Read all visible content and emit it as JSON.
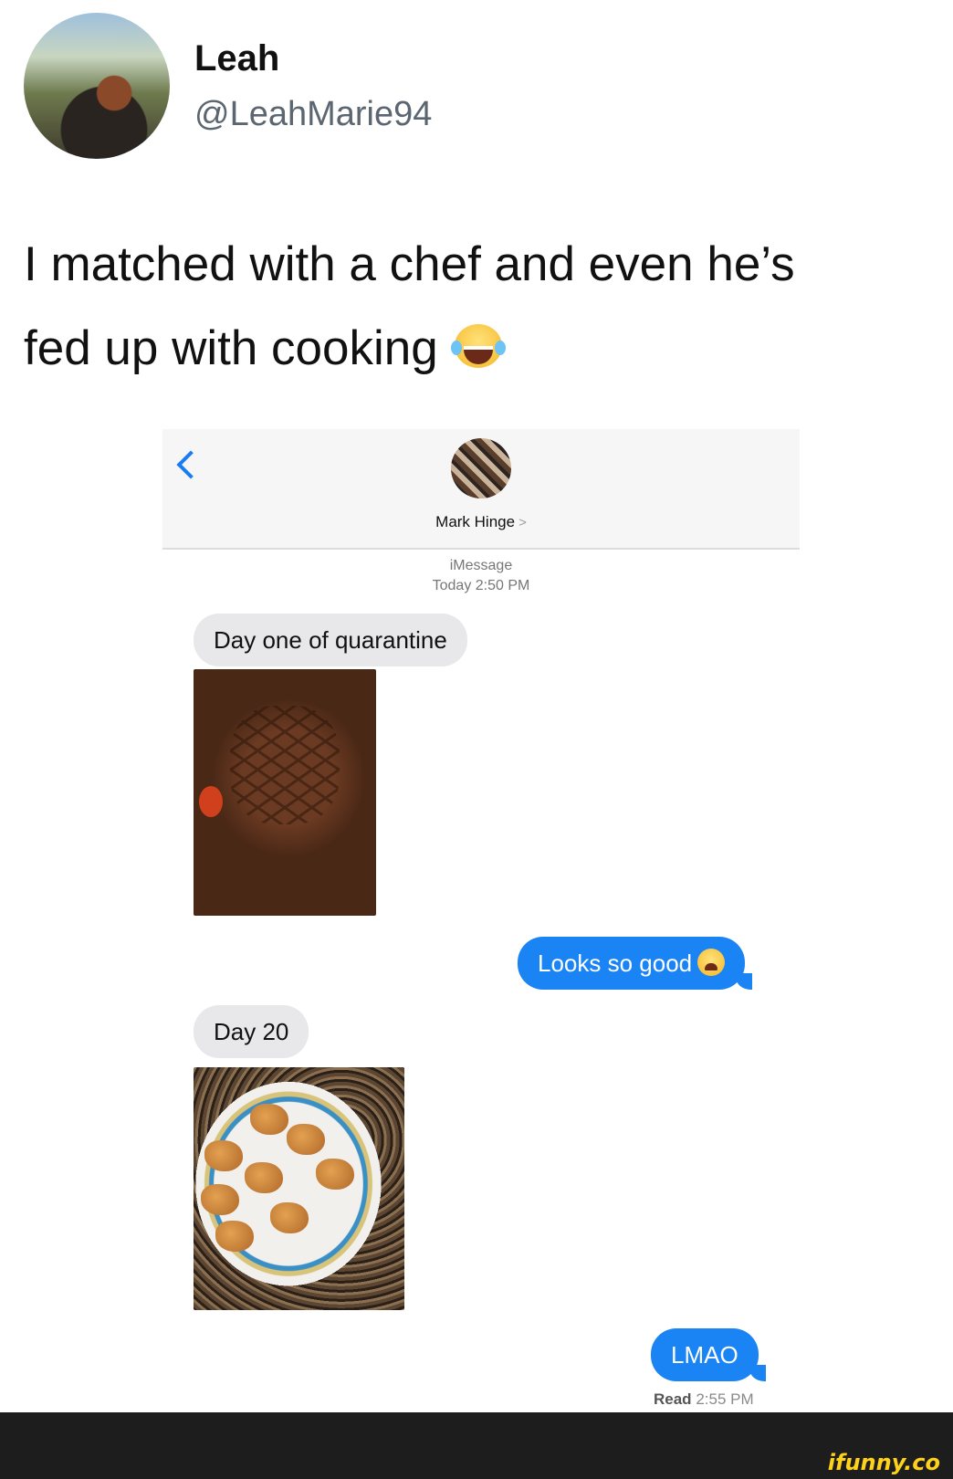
{
  "tweet": {
    "display_name": "Leah",
    "handle": "@LeahMarie94",
    "text_line1": "I matched with a chef and even he’s",
    "text_line2": "fed up with cooking",
    "emoji": "face-with-tears-of-joy"
  },
  "conversation": {
    "contact_name": "Mark Hinge",
    "contact_chevron": ">",
    "service": "iMessage",
    "timestamp": "Today 2:50 PM",
    "messages": [
      {
        "direction": "incoming",
        "text": "Day one of quarantine"
      },
      {
        "direction": "incoming",
        "image": "steak-photo"
      },
      {
        "direction": "outgoing",
        "text": "Looks so good",
        "emoji": "weary-face"
      },
      {
        "direction": "incoming",
        "text": "Day 20"
      },
      {
        "direction": "incoming",
        "image": "chicken-nuggets-photo"
      },
      {
        "direction": "outgoing",
        "text": "LMAO"
      }
    ],
    "read_label": "Read",
    "read_time": "2:55 PM"
  },
  "watermark": "ifunny.co",
  "colors": {
    "outgoing_bubble": "#1a84f5",
    "incoming_bubble": "#e8e8ea",
    "accent_back": "#1a7cf2",
    "watermark": "#ffd119"
  }
}
